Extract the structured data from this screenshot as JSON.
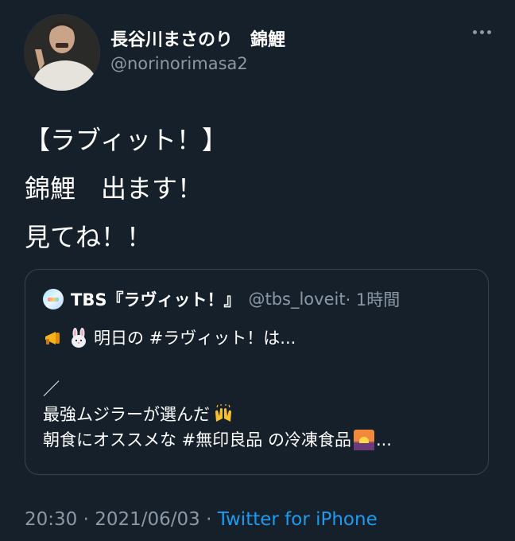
{
  "tweet": {
    "display_name": "長谷川まさのり　錦鯉",
    "handle": "@norinorimasa2",
    "text_lines": [
      "【ラブィット！】",
      "錦鯉　出ます！",
      "見てね！！"
    ]
  },
  "quoted": {
    "name": "TBS『ラヴィット！』",
    "handle": "@tbs_loveit",
    "time": "· 1時間",
    "line1": "明日の #ラヴィット！は...",
    "line2": "／",
    "line3": "最強ムジラーが選んだ",
    "line4": "朝食にオススメな #無印良品 の冷凍食品",
    "line4_suffix": "...",
    "icons": [
      "megaphone-emoji",
      "rabbit-face-emoji",
      "raising-hands-emoji",
      "sunrise-emoji"
    ]
  },
  "footer": {
    "time": "20:30",
    "sep1": " · ",
    "date": "2021/06/03",
    "sep2": " · ",
    "source": "Twitter for iPhone"
  }
}
